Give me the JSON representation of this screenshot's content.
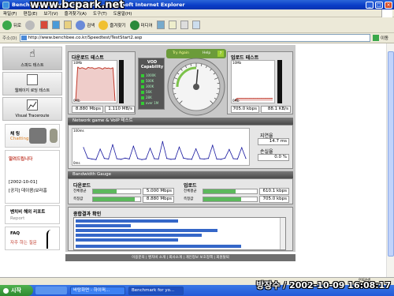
{
  "window": {
    "title": "Benchmark for you - Benchbee - Microsoft Internet Explorer"
  },
  "watermark": "www.bcpark.net",
  "menu": [
    "파일(F)",
    "편집(E)",
    "보기(V)",
    "즐겨찾기(A)",
    "도구(T)",
    "도움말(H)"
  ],
  "toolbar": {
    "back": "뒤로",
    "search": "검색",
    "favorites": "즐겨찾기",
    "media": "미디어"
  },
  "address": {
    "label": "주소(D)",
    "url": "http://www.benchbee.co.kr/Speedtest/TestStart2.asp",
    "go": "이동"
  },
  "sidebar": {
    "nav": [
      "스피드 테스트",
      "웹페이지 로딩 테스트",
      "Visual Traceroute"
    ],
    "chat_label": "채 팅",
    "chat_sub": "Chatting",
    "notice_title": "알려드립니다",
    "notice_date": "[2002-10-01]",
    "notice_text": "[공지] 데이콤(보라홈",
    "report_title": "벤치비 해외 리포트",
    "report_sub": "Report",
    "faq_title": "FAQ",
    "faq_sub": "자주 하는 질문"
  },
  "download": {
    "title": "다운로드 테스트",
    "axis_max": "10Mb",
    "axis_min": "0Mb",
    "mbps": "8.880 Mbps",
    "mbs": "1.110 MB/s"
  },
  "vod": {
    "title": "VOD Capability",
    "levels": [
      "1000K",
      "500K",
      "300K",
      "56K",
      "28K",
      "over 1M"
    ]
  },
  "gauge": {
    "tab_left": "Try Again",
    "tab_right": "Help",
    "tab_help": "?"
  },
  "upload": {
    "title": "업로드 테스트",
    "axis_max": "10Mb",
    "axis_min": "0Mb",
    "kbps": "705.0 kbps",
    "kbs": "88.1 KB/s"
  },
  "voip": {
    "title": "Network game & VoIP 테스트",
    "axis_max": "100ms",
    "axis_min": "0ms",
    "latency_label": "지연율",
    "latency": "14.7 ms",
    "loss_label": "손실율",
    "loss": "0.0 %"
  },
  "bandwidth": {
    "title": "Bandwidth Gauge",
    "down_title": "다운로드",
    "down_rows": [
      {
        "label": "전체평균",
        "value": "5.000 Mbps"
      },
      {
        "label": "측정값",
        "value": "8.880 Mbps"
      }
    ],
    "up_title": "업로드",
    "up_rows": [
      {
        "label": "전체평균",
        "value": "610.1 kbps"
      },
      {
        "label": "측정값",
        "value": "705.0 kbps"
      }
    ]
  },
  "result": {
    "title": "종합결과 확인"
  },
  "footer": "이용문의  |  벤치비 소개  |  회사소개  |  개인정보 보호정책  |  회원탈퇴",
  "status": {
    "zone": "인터넷"
  },
  "taskbar": {
    "start": "시작",
    "tasks": [
      "바탕화면 - 하이퍼...",
      "Benchmark for yo..."
    ]
  },
  "stamp": "방장수 / 2002-10-09 16:08:17",
  "colors": {
    "accent": "#2c66d8",
    "chart_line": "#1a1aa0",
    "progress": "#5cb85c",
    "selection": "#3567c8"
  },
  "chart_data": [
    {
      "type": "area",
      "title": "다운로드 테스트",
      "ylim": [
        0,
        10
      ],
      "x": [
        0,
        1,
        2,
        3,
        4,
        5,
        6,
        7,
        8,
        9,
        10,
        11,
        12,
        13,
        14,
        15,
        16,
        17,
        18,
        19
      ],
      "values": [
        0,
        9.2,
        8.7,
        9.0,
        8.8,
        8.6,
        9.1,
        8.9,
        9.0,
        8.7,
        8.8,
        9.0,
        8.9,
        8.6,
        9.0,
        8.8,
        8.9,
        8.7,
        9.0,
        0
      ]
    },
    {
      "type": "area",
      "title": "업로드 테스트",
      "ylim": [
        0,
        10
      ],
      "x": [
        0,
        1,
        2,
        3,
        4,
        5,
        6,
        7,
        8,
        9,
        10,
        11,
        12,
        13,
        14,
        15,
        16,
        17,
        18,
        19
      ],
      "values": [
        0,
        0.7,
        0.7,
        0.7,
        0.7,
        0.7,
        0.7,
        0.7,
        0.7,
        0.7,
        0.7,
        0.7,
        0.7,
        0.7,
        0.7,
        0.7,
        0.7,
        0.7,
        0.7,
        0.7
      ]
    },
    {
      "type": "line",
      "title": "Network game & VoIP 테스트",
      "ylim": [
        0,
        100
      ],
      "x": [
        0,
        1,
        2,
        3,
        4,
        5,
        6,
        7,
        8,
        9,
        10,
        11,
        12,
        13,
        14,
        15,
        16,
        17,
        18,
        19,
        20,
        21,
        22,
        23,
        24,
        25,
        26,
        27,
        28,
        29,
        30,
        31,
        32,
        33,
        34,
        35,
        36,
        37,
        38,
        39
      ],
      "values": [
        50,
        15,
        12,
        10,
        45,
        14,
        12,
        60,
        13,
        11,
        15,
        12,
        55,
        14,
        10,
        12,
        48,
        13,
        12,
        70,
        14,
        11,
        12,
        52,
        15,
        12,
        11,
        46,
        13,
        12,
        14,
        58,
        12,
        11,
        15,
        44,
        13,
        12,
        50,
        14
      ]
    }
  ]
}
